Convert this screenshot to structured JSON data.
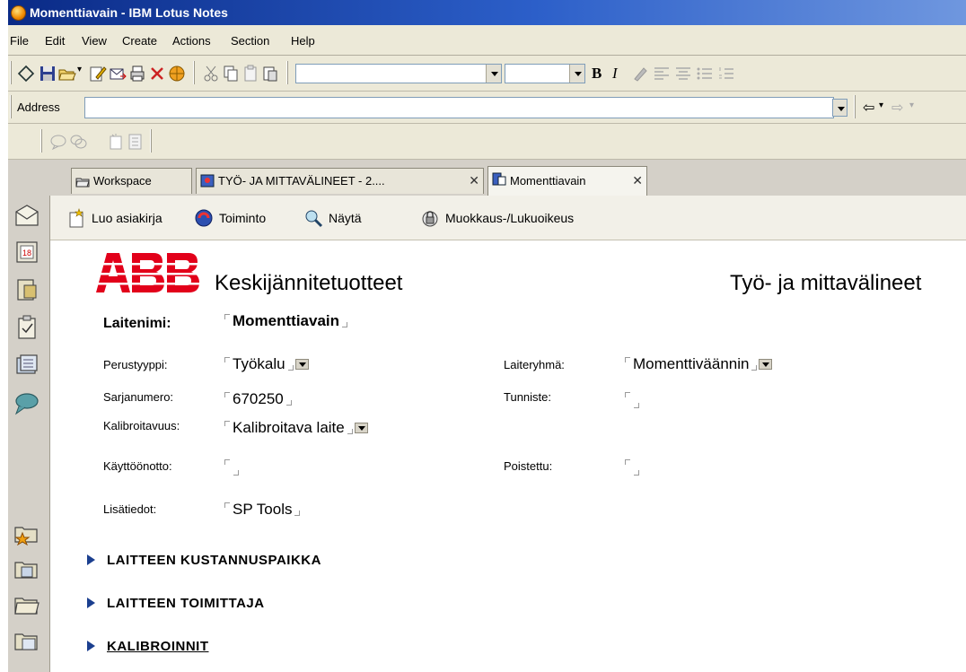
{
  "window": {
    "title": "Momenttiavain - IBM Lotus Notes"
  },
  "menu": [
    "File",
    "Edit",
    "View",
    "Create",
    "Actions",
    "Section",
    "Help"
  ],
  "toolbar": {
    "bold_label": "B",
    "italic_label": "I"
  },
  "address_bar": {
    "label": "Address",
    "value": ""
  },
  "tabs": [
    {
      "label": "Workspace",
      "closable": false,
      "active": false,
      "icon": "workspace-icon"
    },
    {
      "label": "TYÖ- JA MITTAVÄLINEET - 2....",
      "closable": true,
      "active": false,
      "icon": "database-icon"
    },
    {
      "label": "Momenttiavain",
      "closable": true,
      "active": true,
      "icon": "document-icon"
    }
  ],
  "tab_close_glyph": "✕",
  "actions": [
    {
      "label": "Luo asiakirja",
      "icon": "new-document-icon"
    },
    {
      "label": "Toiminto",
      "icon": "action-icon"
    },
    {
      "label": "Näytä",
      "icon": "magnifier-icon"
    },
    {
      "label": "Muokkaus-/Lukuoikeus",
      "icon": "access-lock-icon"
    }
  ],
  "doc": {
    "logo_text": "ABB",
    "company": "Keskijännitetuotteet",
    "title": "Työ- ja mittavälineet",
    "device_name_label": "Laitenimi:",
    "device_name": "Momenttiavain",
    "fields": {
      "perustyyppi": {
        "label": "Perustyyppi:",
        "value": "Työkalu"
      },
      "laiteryhma": {
        "label": "Laiteryhmä:",
        "value": "Momenttiväännin"
      },
      "sarjanumero": {
        "label": "Sarjanumero:",
        "value": "670250"
      },
      "tunniste": {
        "label": "Tunniste:",
        "value": ""
      },
      "kalibroitavuus": {
        "label": "Kalibroitavuus:",
        "value": "Kalibroitava laite"
      },
      "kayttoonotto": {
        "label": "Käyttöönotto:",
        "value": ""
      },
      "poistettu": {
        "label": "Poistettu:",
        "value": ""
      },
      "lisatiedot": {
        "label": "Lisätiedot:",
        "value": "SP Tools"
      }
    },
    "sections": [
      {
        "label": "LAITTEEN KUSTANNUSPAIKKA"
      },
      {
        "label": "LAITTEEN TOIMITTAJA"
      },
      {
        "label": "KALIBROINNIT"
      }
    ]
  },
  "colors": {
    "title_bar": "#0a2a86",
    "abb_red": "#e2001a",
    "section_arrow": "#1b3f8f"
  }
}
